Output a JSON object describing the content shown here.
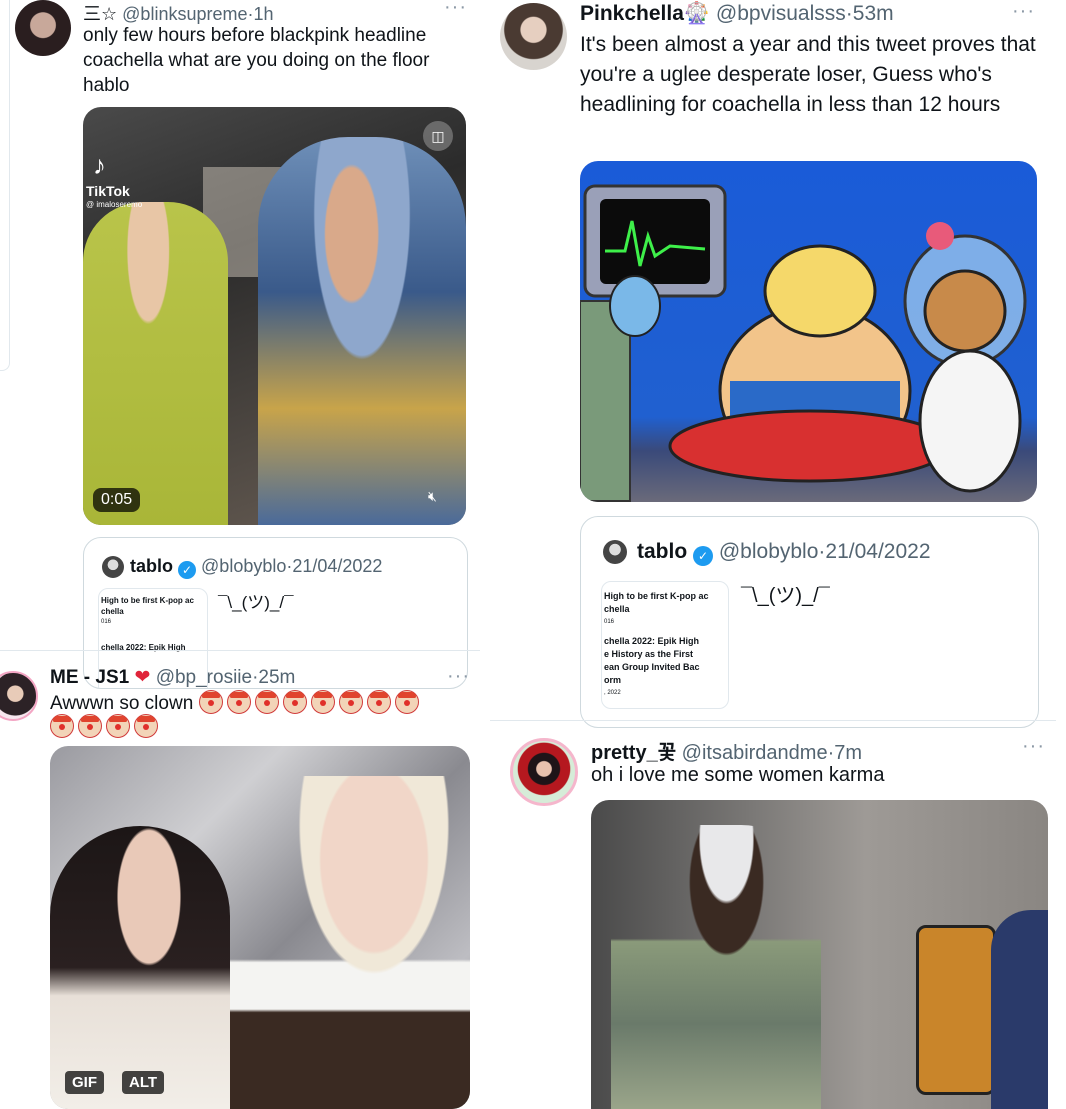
{
  "tweets": [
    {
      "name": "三☆",
      "handle": "@blinksupreme",
      "time": "1h",
      "text": "only few hours before blackpink headline coachella what are you doing on the floor hablo",
      "video": {
        "tiktok_label": "TikTok",
        "tiktok_user": "@ imaloseremo",
        "duration": "0:05"
      },
      "quote": {
        "name": "tablo",
        "handle": "@blobyblo",
        "date": "21/04/2022",
        "text": "¯\\_(ツ)_/¯",
        "thumb_lines": [
          "High to be first K-pop ac",
          "chella",
          "016",
          "chella 2022: Epik High"
        ]
      }
    },
    {
      "name": "Pinkchella",
      "handle": "@bpvisualsss",
      "time": "53m",
      "text": "It's been almost a year and this tweet proves that you're a uglee desperate loser, Guess who's headlining for coachella in less than 12 hours",
      "quote": {
        "name": "tablo",
        "handle": "@blobyblo",
        "date": "21/04/2022",
        "text": "¯\\_(ツ)_/¯",
        "thumb_lines": [
          "High to be first K-pop ac",
          "chella",
          "016",
          "chella 2022: Epik High",
          "e History as the First",
          "ean Group Invited Bac",
          "orm",
          ", 2022"
        ]
      }
    },
    {
      "name": "ME - JS1",
      "handle": "@bp_rosiie",
      "time": "25m",
      "text": "Awwwn so clown",
      "clown_count_line1": 8,
      "clown_count_line2": 4,
      "media_badges": {
        "gif": "GIF",
        "alt": "ALT"
      }
    },
    {
      "name": "pretty_꽃",
      "handle": "@itsabirdandme",
      "time": "7m",
      "text": "oh i love me some women karma"
    }
  ],
  "icons": {
    "more": "more-dots-icon",
    "mute": "mute-icon",
    "verified": "verified-badge-icon"
  },
  "colors": {
    "handle": "#536471",
    "verified": "#1d9bf0",
    "border": "#cfd9de"
  }
}
